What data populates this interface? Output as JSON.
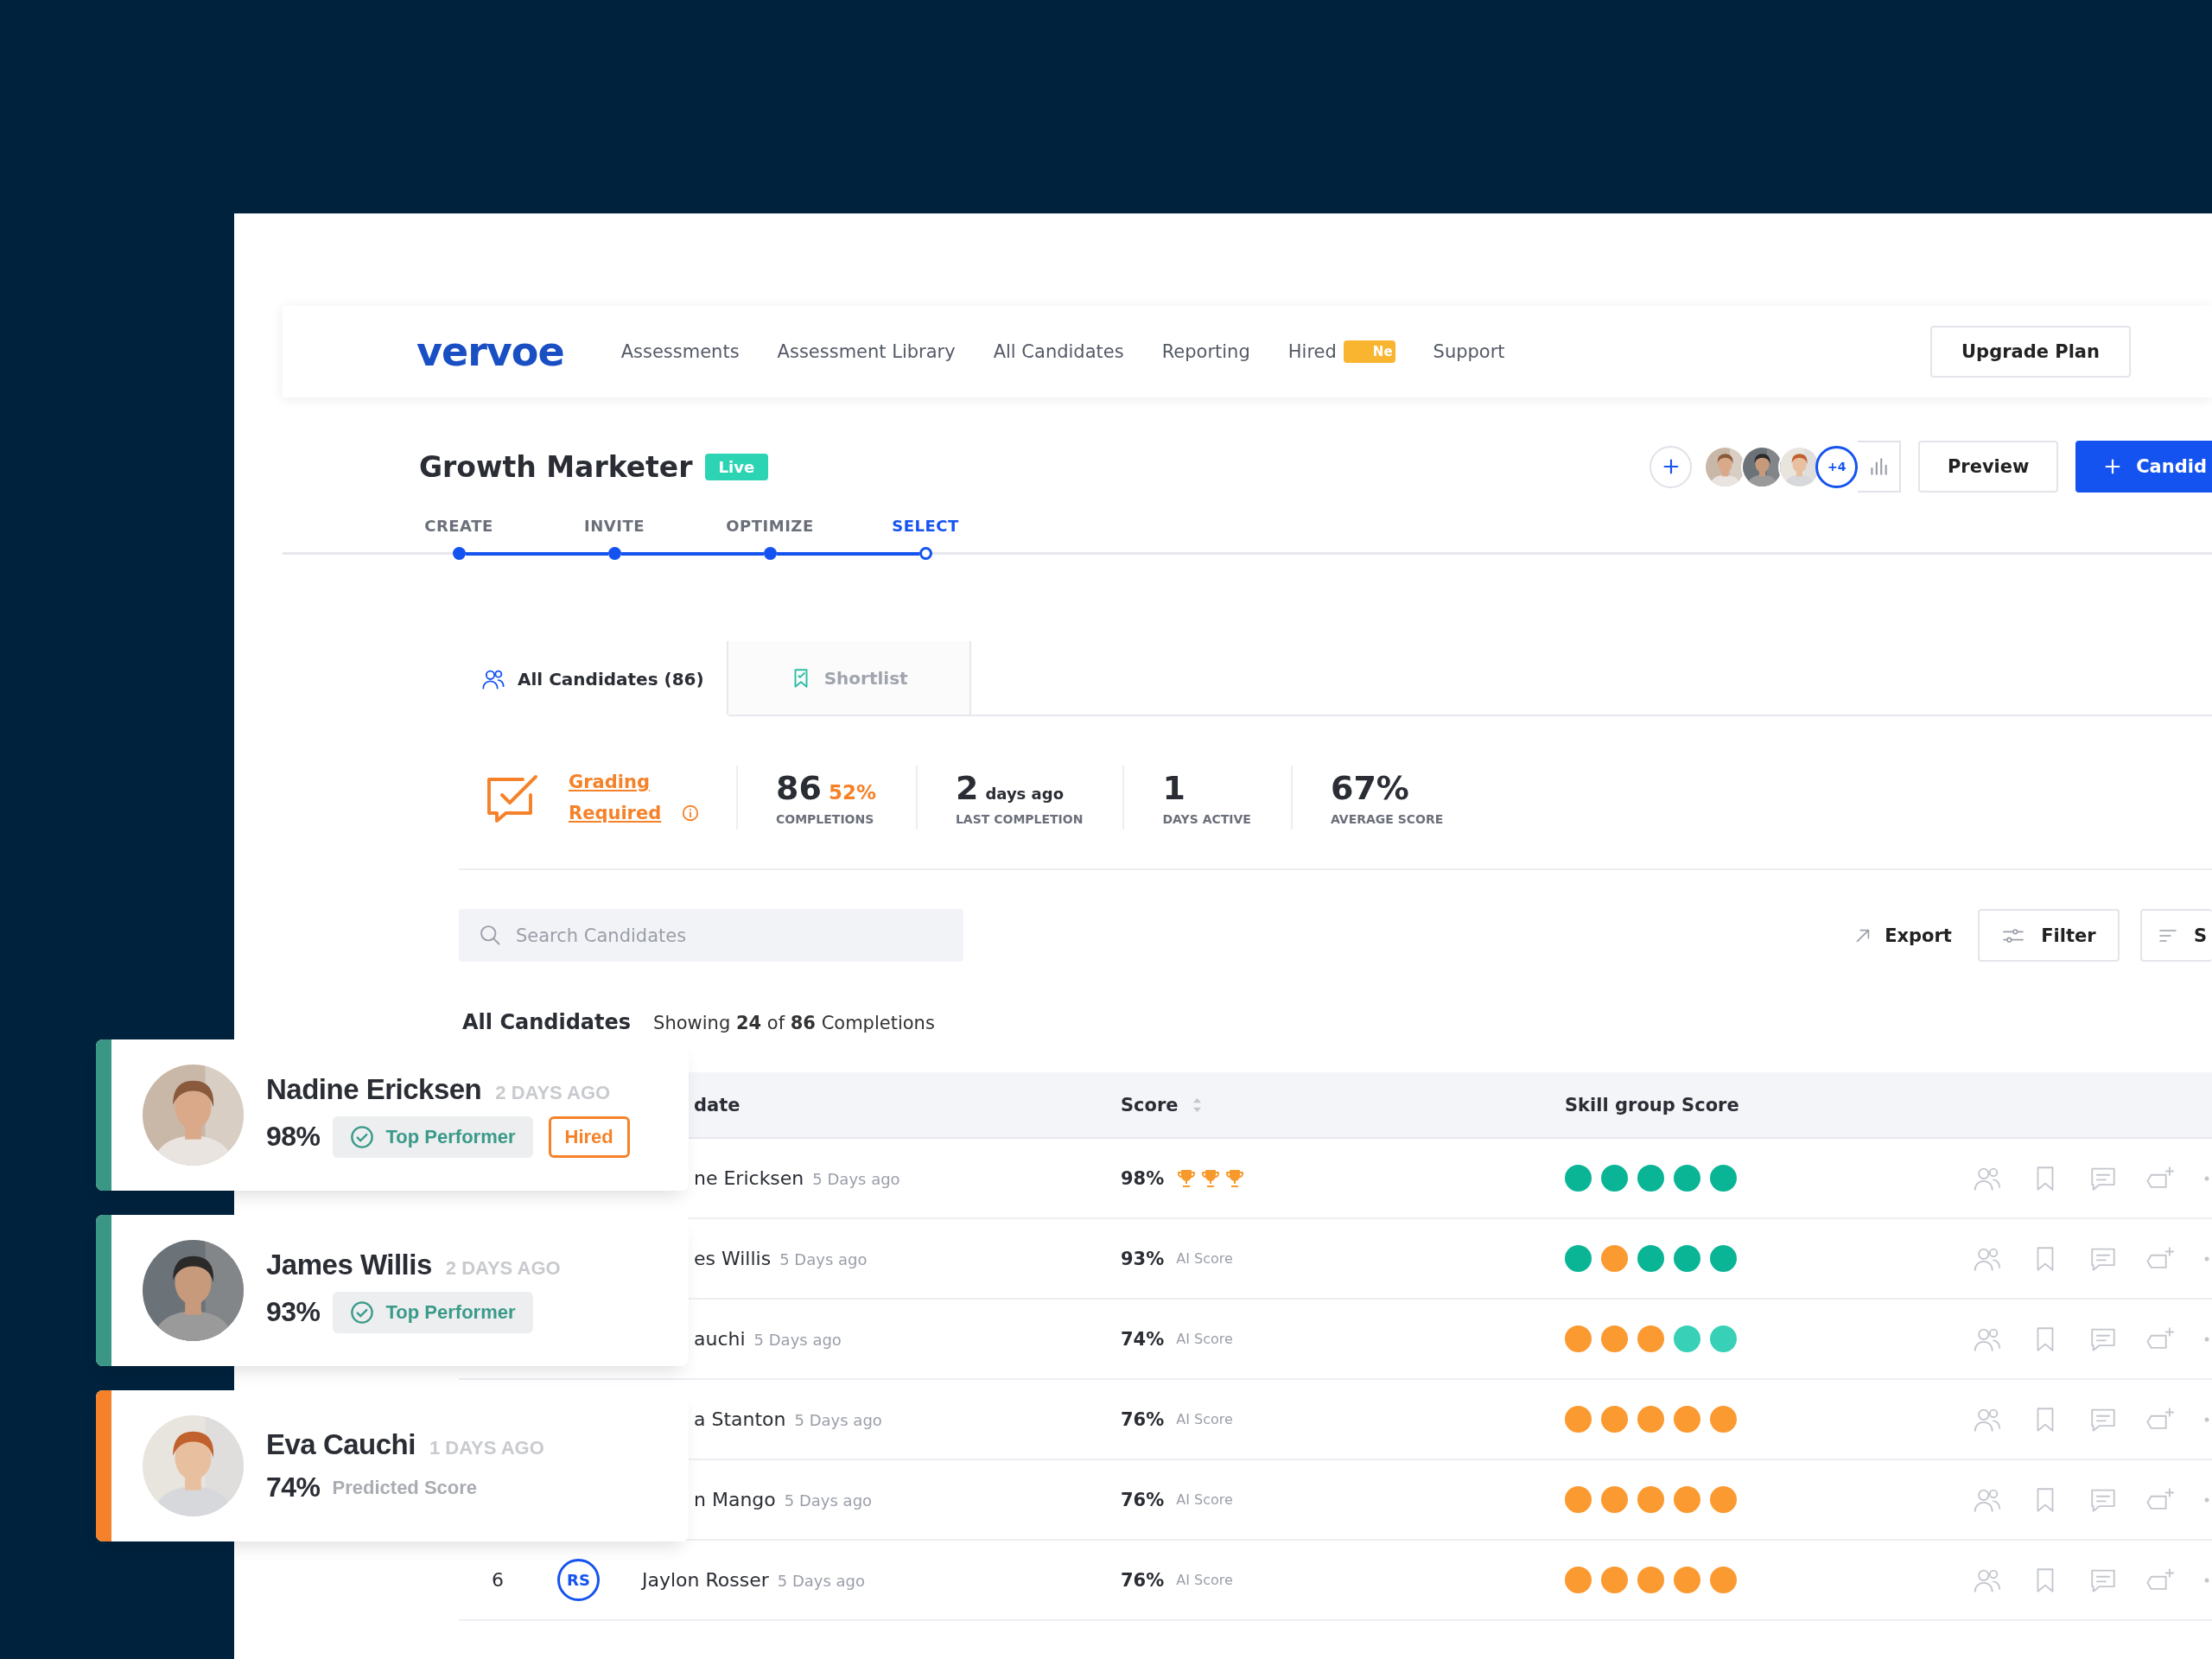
{
  "nav": {
    "logo": "vervoe",
    "items": [
      {
        "label": "Assessments"
      },
      {
        "label": "Assessment Library"
      },
      {
        "label": "All Candidates"
      },
      {
        "label": "Reporting"
      },
      {
        "label": "Hired",
        "badge": "Ne"
      },
      {
        "label": "Support"
      }
    ],
    "upgrade_button": "Upgrade Plan"
  },
  "assessment": {
    "title": "Growth Marketer",
    "status": "Live",
    "team_more": "+4",
    "preview_button": "Preview",
    "primary_button": "Candid"
  },
  "steps": [
    {
      "label": "CREATE",
      "done": true,
      "selected": false
    },
    {
      "label": "INVITE",
      "done": true,
      "selected": false
    },
    {
      "label": "OPTIMIZE",
      "done": true,
      "selected": false
    },
    {
      "label": "SELECT",
      "done": false,
      "selected": true
    }
  ],
  "tabs": [
    {
      "label": "All Candidates (86)",
      "kind": "people",
      "selected": true
    },
    {
      "label": "Shortlist",
      "kind": "shortlist",
      "selected": false
    }
  ],
  "grading": {
    "label": "Grading Required"
  },
  "stats": [
    {
      "value": "86",
      "extra": "52%",
      "label": "COMPLETIONS"
    },
    {
      "value": "2",
      "unit": "days ago",
      "label": "LAST COMPLETION"
    },
    {
      "value": "1",
      "label": "DAYS ACTIVE"
    },
    {
      "value": "67%",
      "label": "AVERAGE SCORE"
    }
  ],
  "toolbar": {
    "search": {
      "placeholder": "Search Candidates"
    },
    "export": "Export",
    "filter": "Filter",
    "sort": "S"
  },
  "summary": {
    "title": "All Candidates",
    "text": "Showing **24** of **86** Completions"
  },
  "table": {
    "columns": [
      "date",
      "Score",
      "Skill group Score"
    ],
    "rows": [
      {
        "name": "ne Ericksen",
        "time": "5 Days ago",
        "score": "98%",
        "stars": 3,
        "skills": [
          {
            "color": "#0ab596"
          },
          {
            "color": "#0ab596"
          },
          {
            "color": "#0ab596"
          },
          {
            "color": "#0ab596"
          },
          {
            "color": "#0ab596"
          }
        ]
      },
      {
        "name": "es Willis",
        "time": "5 Days ago",
        "score": "93%",
        "score_label": "AI Score",
        "skills": [
          {
            "color": "#0ab596"
          },
          {
            "color": "#fb9a31"
          },
          {
            "color": "#0ab596"
          },
          {
            "color": "#0ab596"
          },
          {
            "color": "#0ab596"
          }
        ]
      },
      {
        "name": "auchi",
        "time": "5 Days ago",
        "score": "74%",
        "score_label": "AI Score",
        "skills": [
          {
            "color": "#fb9a31"
          },
          {
            "color": "#fb9a31"
          },
          {
            "color": "#fb9a31"
          },
          {
            "color": "#38d1b8"
          },
          {
            "color": "#38d1b8"
          }
        ]
      },
      {
        "name": "a Stanton",
        "time": "5 Days ago",
        "score": "76%",
        "score_label": "AI Score",
        "skills": [
          {
            "color": "#fb9a31"
          },
          {
            "color": "#fb9a31"
          },
          {
            "color": "#fb9a31"
          },
          {
            "color": "#fb9a31"
          },
          {
            "color": "#fb9a31"
          }
        ]
      },
      {
        "name": "n Mango",
        "time": "5 Days ago",
        "score": "76%",
        "score_label": "AI Score",
        "skills": [
          {
            "color": "#fb9a31"
          },
          {
            "color": "#fb9a31"
          },
          {
            "color": "#fb9a31"
          },
          {
            "color": "#fb9a31"
          },
          {
            "color": "#fb9a31"
          }
        ]
      },
      {
        "number": "6",
        "initials": "RS",
        "name": "Jaylon Rosser",
        "time": "5 Days ago",
        "score": "76%",
        "score_label": "AI Score",
        "skills": [
          {
            "color": "#fb9a31"
          },
          {
            "color": "#fb9a31"
          },
          {
            "color": "#fb9a31"
          },
          {
            "color": "#fb9a31"
          },
          {
            "color": "#fb9a31"
          }
        ]
      }
    ]
  },
  "cards": [
    {
      "name": "Nadine Ericksen",
      "time": "2 DAYS AGO",
      "score": "98%",
      "badge": "Top Performer",
      "status": "Hired",
      "color": "#3b9785"
    },
    {
      "name": "James Willis",
      "time": "2 DAYS AGO",
      "score": "93%",
      "badge": "Top Performer",
      "color": "#3b9785"
    },
    {
      "name": "Eva Cauchi",
      "time": "1 DAYS AGO",
      "score": "74%",
      "note": "Predicted Score",
      "color": "#f5822a"
    }
  ]
}
